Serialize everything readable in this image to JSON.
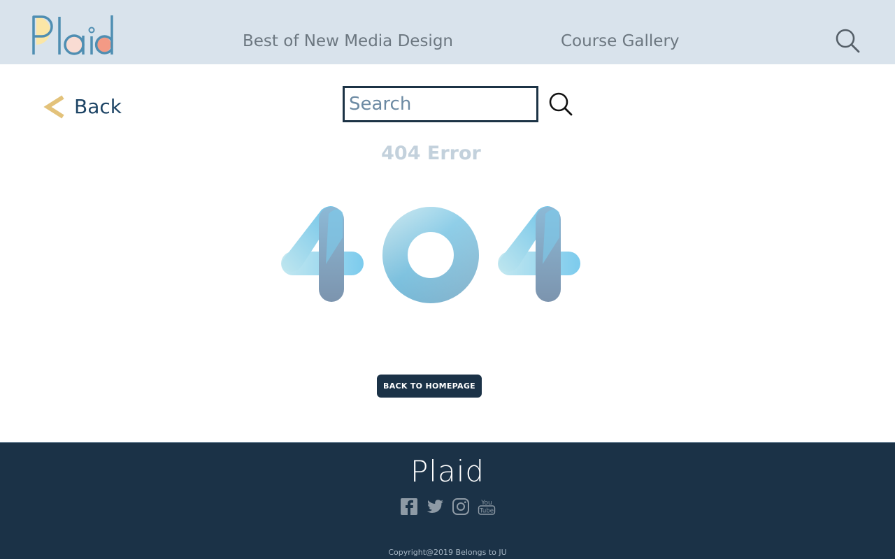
{
  "header": {
    "logo_text": "Plaid",
    "nav": {
      "best_label": "Best of New Media Design",
      "gallery_label": "Course Gallery"
    },
    "search_icon": "search-icon"
  },
  "back": {
    "label": "Back",
    "icon": "chevron-left-icon"
  },
  "search": {
    "placeholder": "Search",
    "value": "",
    "icon": "search-icon"
  },
  "error": {
    "title": "404 Error",
    "graphic_text": "404",
    "button_label": "BACK TO HOMEPAGE"
  },
  "footer": {
    "logo_text": "Plaid",
    "social": [
      {
        "name": "facebook",
        "icon": "facebook-icon"
      },
      {
        "name": "twitter",
        "icon": "twitter-icon"
      },
      {
        "name": "instagram",
        "icon": "instagram-icon"
      },
      {
        "name": "youtube",
        "icon": "youtube-icon",
        "label": "You Tube"
      }
    ],
    "copyright": "Copyright@2019 Belongs to JU"
  },
  "colors": {
    "header_bg": "#d9e3ec",
    "footer_bg": "#1b3247",
    "accent_gold": "#e3c27a",
    "accent_blue": "#1d4465",
    "error_title": "#c3d1dc",
    "nav_text": "#6c7780",
    "logo_blue": "#4f8eb2",
    "logo_yellow": "#fbe6a6",
    "logo_pink": "#f9dcd3",
    "logo_coral": "#f39a85"
  }
}
